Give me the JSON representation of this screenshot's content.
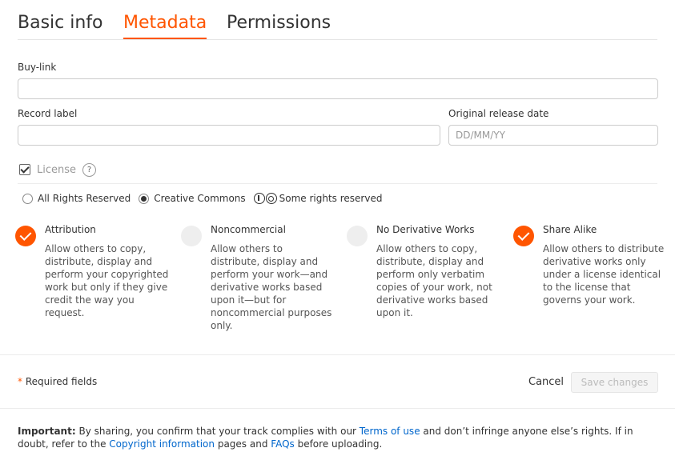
{
  "tabs": [
    {
      "label": "Basic info",
      "active": false
    },
    {
      "label": "Metadata",
      "active": true
    },
    {
      "label": "Permissions",
      "active": false
    }
  ],
  "fields": {
    "buy_link": {
      "label": "Buy-link",
      "value": "",
      "placeholder": ""
    },
    "record_label": {
      "label": "Record label",
      "value": "",
      "placeholder": ""
    },
    "release_date": {
      "label": "Original release date",
      "value": "",
      "placeholder": "DD/MM/YY"
    }
  },
  "license": {
    "label": "License",
    "help_icon": "question-icon",
    "checked": true,
    "help_glyph": "?"
  },
  "license_type": {
    "all_rights": "All Rights Reserved",
    "creative_commons": "Creative Commons",
    "selected": "creative_commons",
    "some_rights": "Some rights reserved"
  },
  "options": [
    {
      "title": "Attribution",
      "checked": true,
      "desc": "Allow others to copy, distribute, display and perform your copyrighted work but only if they give credit the way you request."
    },
    {
      "title": "Noncommercial",
      "checked": false,
      "desc": "Allow others to distribute, display and perform your work—and derivative works based upon it—but for noncommercial purposes only."
    },
    {
      "title": "No Derivative Works",
      "checked": false,
      "desc": "Allow others to copy, distribute, display and perform only verbatim copies of your work, not derivative works based upon it."
    },
    {
      "title": "Share Alike",
      "checked": true,
      "desc": "Allow others to distribute derivative works only under a license identical to the license that governs your work."
    }
  ],
  "footer": {
    "required_star": "*",
    "required_text": "Required fields",
    "cancel": "Cancel",
    "save": "Save changes"
  },
  "important": {
    "lead": "Important:",
    "t1": " By sharing, you confirm that your track complies with our ",
    "terms_link": "Terms of use",
    "t2": " and don’t infringe anyone else’s rights. If in doubt, refer to the ",
    "copyright_link": "Copyright information",
    "t3": " pages and ",
    "faq_link": "FAQs",
    "t4": " before uploading."
  },
  "colors": {
    "accent": "#ff5500",
    "link": "#0066cc"
  }
}
